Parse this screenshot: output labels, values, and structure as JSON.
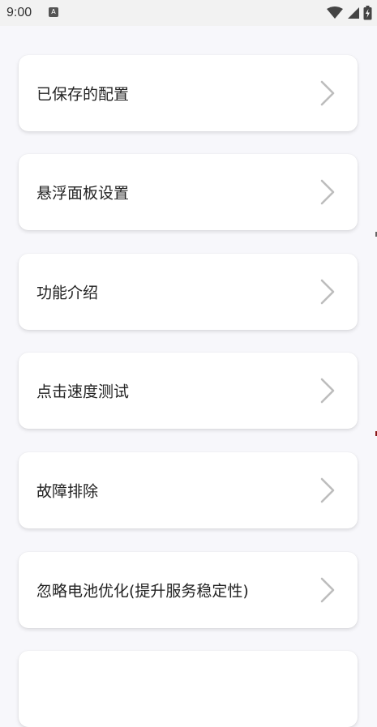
{
  "status_bar": {
    "time": "9:00",
    "notification_icon": "a-letter-icon",
    "icons": [
      "wifi-icon",
      "signal-icon",
      "battery-icon"
    ]
  },
  "menu": {
    "items": [
      {
        "label": "已保存的配置",
        "icon": "chevron-right-icon"
      },
      {
        "label": "悬浮面板设置",
        "icon": "chevron-right-icon"
      },
      {
        "label": "功能介绍",
        "icon": "chevron-right-icon"
      },
      {
        "label": "点击速度测试",
        "icon": "chevron-right-icon"
      },
      {
        "label": "故障排除",
        "icon": "chevron-right-icon"
      },
      {
        "label": "忽略电池优化(提升服务稳定性)",
        "icon": "chevron-right-icon"
      }
    ]
  },
  "colors": {
    "background": "#f7f7fb",
    "card": "#ffffff",
    "text": "#222222",
    "chevron": "#bdbdbd"
  }
}
